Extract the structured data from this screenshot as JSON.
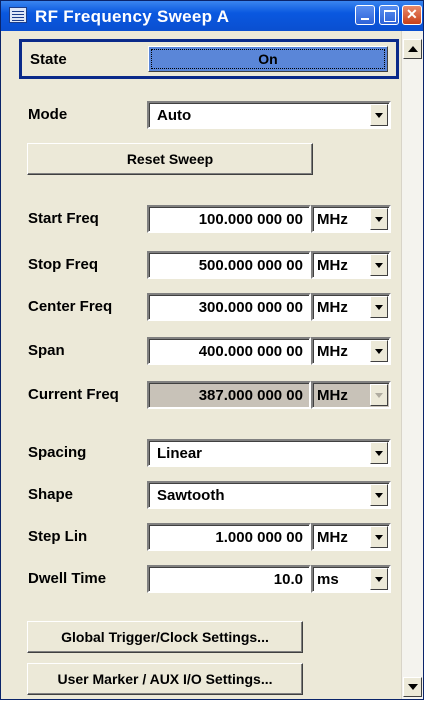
{
  "window": {
    "title": "RF Frequency Sweep  A"
  },
  "state": {
    "label": "State",
    "value": "On"
  },
  "mode": {
    "label": "Mode",
    "value": "Auto"
  },
  "reset_button": "Reset Sweep",
  "freq_rows": [
    {
      "label": "Start Freq",
      "value": "100.000 000 00",
      "unit": "MHz"
    },
    {
      "label": "Stop Freq",
      "value": "500.000 000 00",
      "unit": "MHz"
    },
    {
      "label": "Center Freq",
      "value": "300.000 000 00",
      "unit": "MHz"
    },
    {
      "label": "Span",
      "value": "400.000 000 00",
      "unit": "MHz"
    },
    {
      "label": "Current Freq",
      "value": "387.000 000 00",
      "unit": "MHz"
    }
  ],
  "spacing": {
    "label": "Spacing",
    "value": "Linear"
  },
  "shape": {
    "label": "Shape",
    "value": "Sawtooth"
  },
  "step": {
    "label": "Step Lin",
    "value": "1.000 000 00",
    "unit": "MHz"
  },
  "dwell": {
    "label": "Dwell Time",
    "value": "10.0",
    "unit": "ms"
  },
  "global_trigger_button": "Global Trigger/Clock Settings...",
  "user_marker_button": "User Marker / AUX I/O Settings..."
}
